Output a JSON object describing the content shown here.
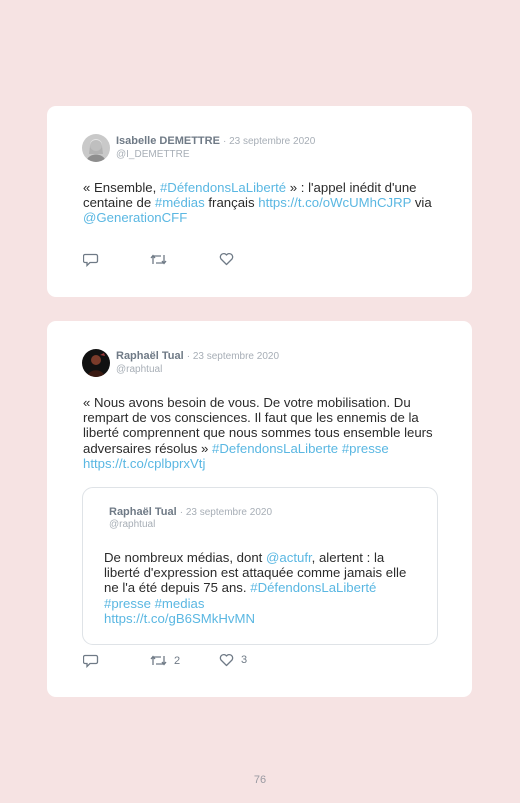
{
  "tweets": [
    {
      "author": "Isabelle DEMETTRE",
      "date": "· 23 septembre 2020",
      "handle": "@I_DEMETTRE",
      "lines": [
        [
          {
            "t": "« Ensemble, "
          },
          {
            "t": "#DéfendonsLaLiberté",
            "h": true
          },
          {
            "t": " » : l'appel inédit d'une"
          }
        ],
        [
          {
            "t": "centaine de "
          },
          {
            "t": "#médias",
            "h": true
          },
          {
            "t": " français "
          },
          {
            "t": "https://t.co/oWcUMhCJRP",
            "h": true
          },
          {
            "t": " via"
          }
        ],
        [
          {
            "t": "@GenerationCFF",
            "h": true
          }
        ]
      ],
      "actions": {
        "reply": "",
        "retweet": "",
        "like": ""
      }
    },
    {
      "author": "Raphaël Tual",
      "date": "· 23 septembre 2020",
      "handle": "@raphtual",
      "lines": [
        [
          {
            "t": "« Nous avons besoin de vous. De votre mobilisation. Du"
          }
        ],
        [
          {
            "t": "rempart de vos consciences. Il faut que les ennemis de la"
          }
        ],
        [
          {
            "t": "liberté comprennent que nous sommes tous ensemble leurs"
          }
        ],
        [
          {
            "t": "adversaires résolus » "
          },
          {
            "t": "#DefendonsLaLiberte",
            "h": true
          },
          {
            "t": " "
          },
          {
            "t": "#presse",
            "h": true
          }
        ],
        [
          {
            "t": "https://t.co/cplbprxVtj",
            "h": true
          }
        ]
      ],
      "quoted": {
        "author": "Raphaël Tual",
        "date": "· 23 septembre 2020",
        "handle": "@raphtual",
        "lines": [
          [
            {
              "t": "De nombreux médias, dont "
            },
            {
              "t": "@actufr",
              "h": true
            },
            {
              "t": ", alertent : la"
            }
          ],
          [
            {
              "t": "liberté d'expression est attaquée comme jamais elle"
            }
          ],
          [
            {
              "t": "ne l'a été depuis 75 ans. "
            },
            {
              "t": "#DéfendonsLaLiberté",
              "h": true
            }
          ],
          [
            {
              "t": "#presse",
              "h": true
            },
            {
              "t": " "
            },
            {
              "t": "#medias",
              "h": true
            }
          ],
          [
            {
              "t": "https://t.co/gB6SMkHvMN",
              "h": true
            }
          ]
        ]
      },
      "actions": {
        "reply": "",
        "retweet": "2",
        "like": "3"
      }
    }
  ],
  "page_number": "76",
  "colors": {
    "background": "#f6e3e3",
    "link": "#5ab7e2",
    "meta": "#a7aeb6"
  },
  "icons": [
    "reply-icon",
    "retweet-icon",
    "like-icon"
  ]
}
